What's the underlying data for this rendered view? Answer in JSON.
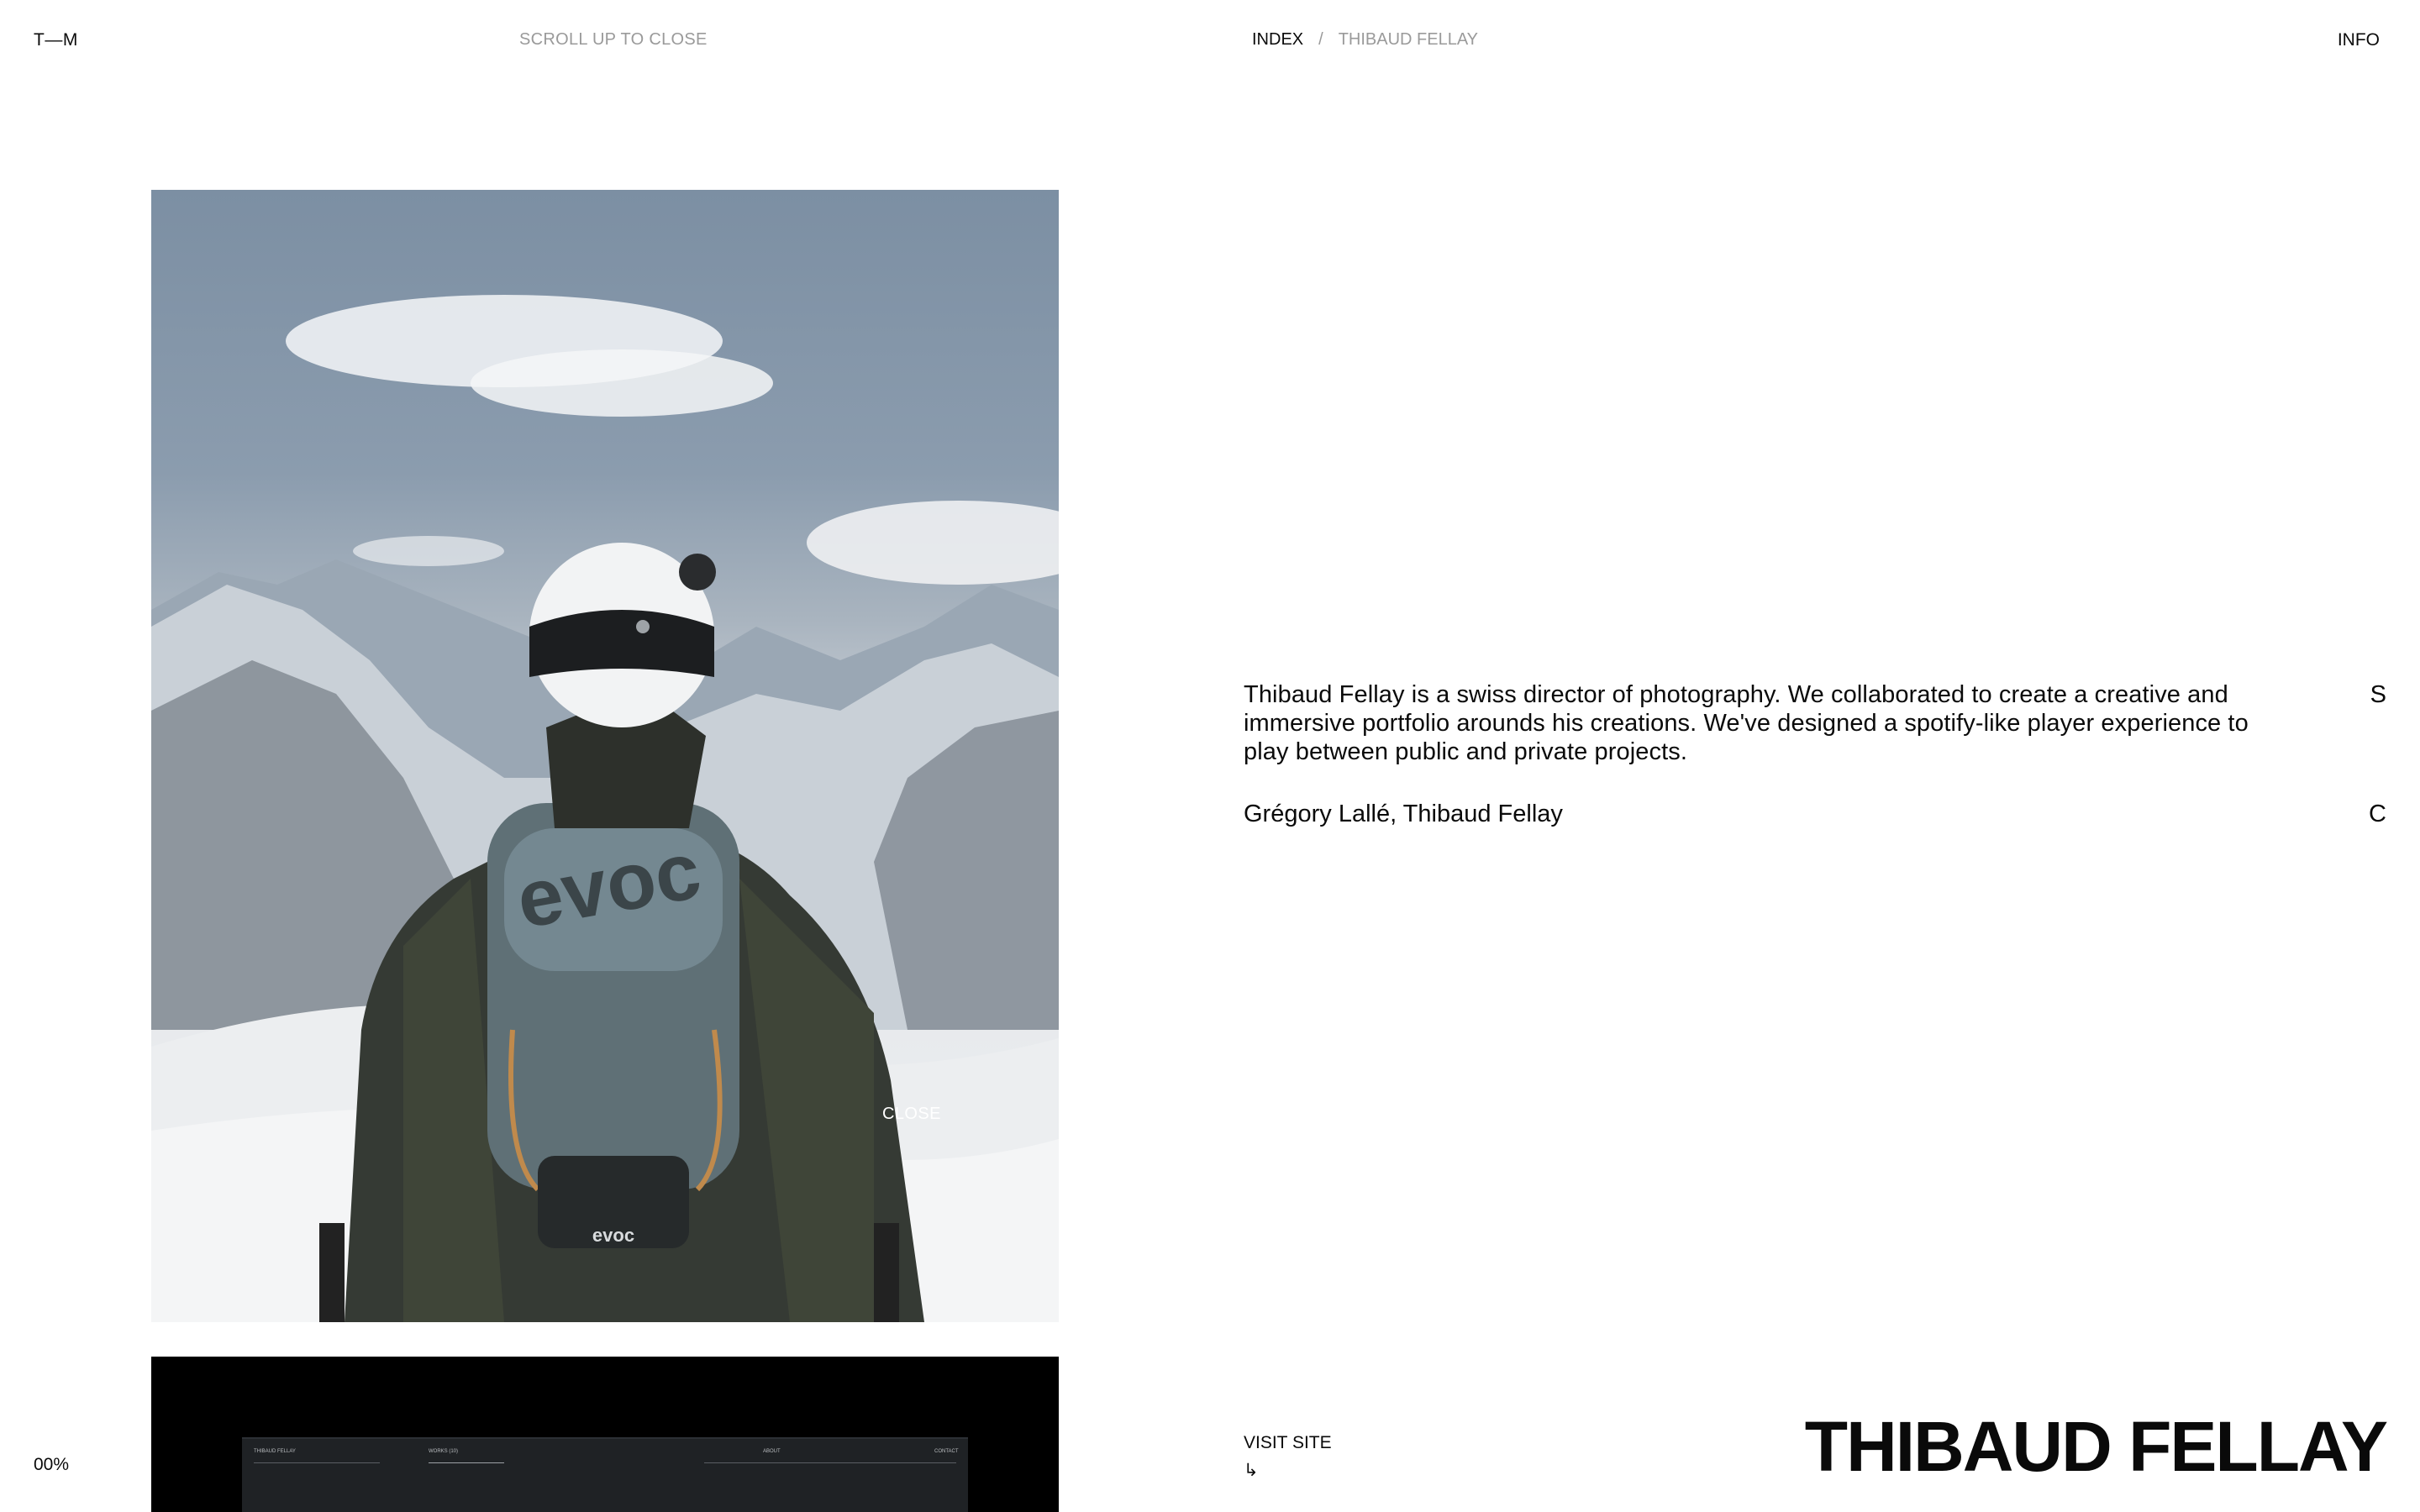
{
  "header": {
    "logo": "T—M",
    "scroll_hint": "SCROLL UP TO CLOSE",
    "breadcrumb": {
      "index": "INDEX",
      "separator": "/",
      "current": "THIBAUD FELLAY"
    },
    "info": "INFO"
  },
  "media": {
    "close_label": "CLOSE",
    "screen_text": {
      "brand": "THIBAUD FELLAY",
      "works": "WORKS (10)",
      "about": "ABOUT",
      "contact": "CONTACT"
    }
  },
  "project": {
    "description": "Thibaud Fellay is a swiss director of photography. We collaborated to create a creative and immersive portfolio arounds his creations. We've designed a spotify-like player experience to play between public and private projects.",
    "credits": "Grégory Lallé, Thibaud Fellay",
    "side_s": "S",
    "side_c": "C",
    "title": "THIBAUD FELLAY"
  },
  "footer": {
    "progress": "00%",
    "visit_site": "VISIT SITE",
    "visit_arrow": "↳"
  },
  "colors": {
    "text": "#0a0a0a",
    "muted": "#9a9a9a",
    "background": "#ffffff"
  }
}
